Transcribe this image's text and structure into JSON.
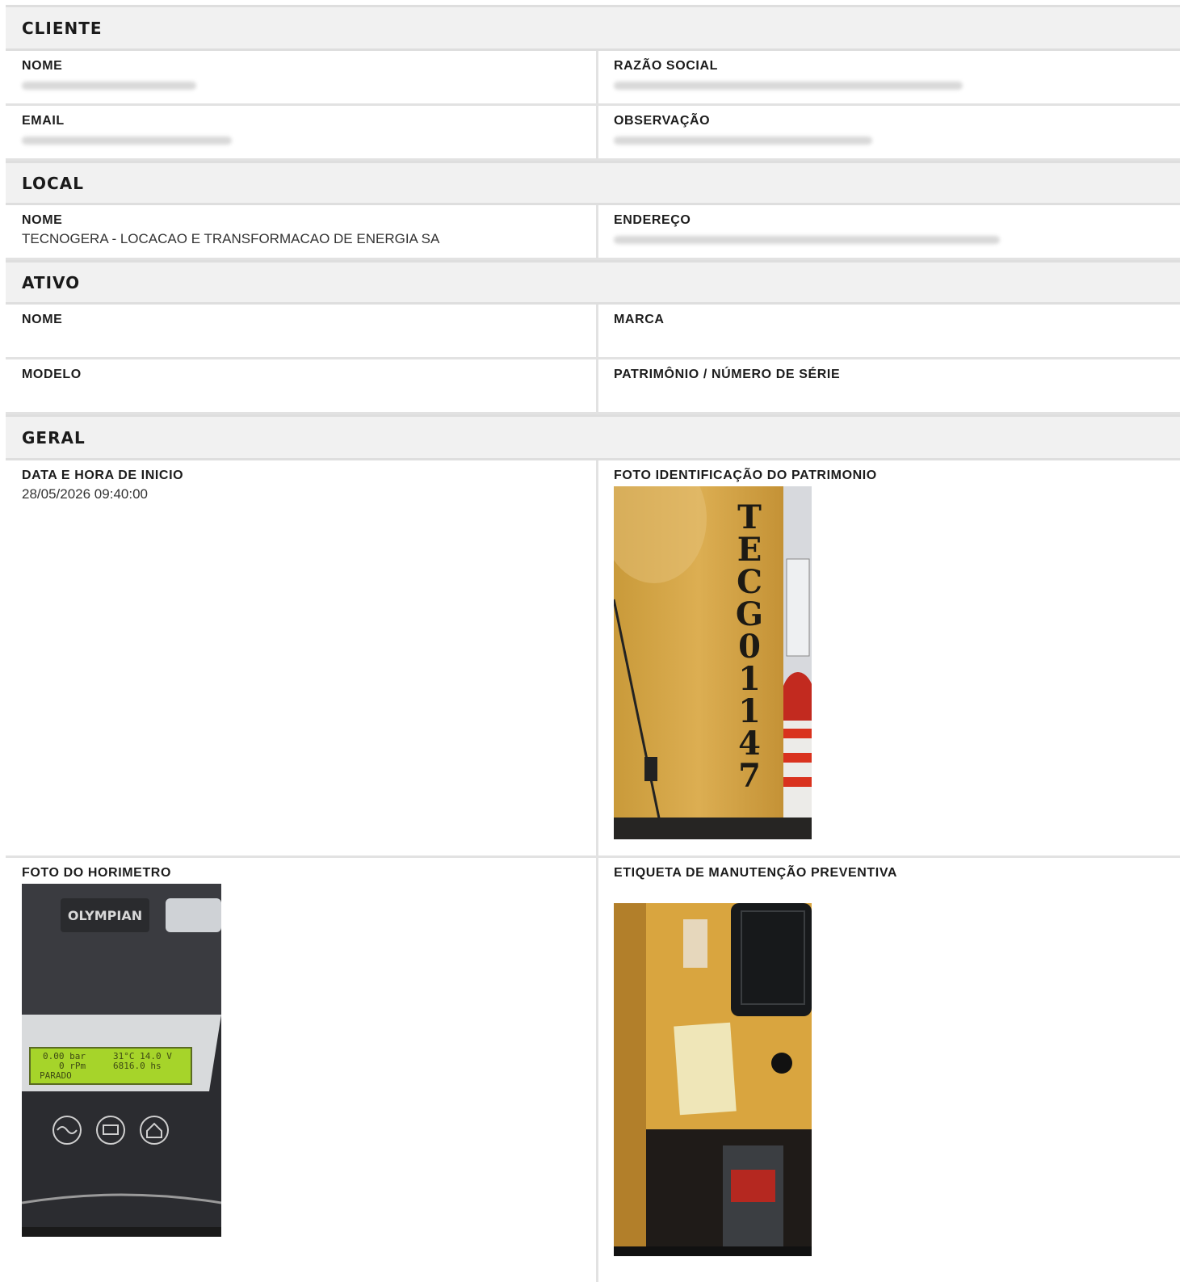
{
  "sections": {
    "cliente": {
      "title": "CLIENTE",
      "nome_label": "NOME",
      "razao_label": "RAZÃO SOCIAL",
      "email_label": "EMAIL",
      "obs_label": "OBSERVAÇÃO"
    },
    "local": {
      "title": "LOCAL",
      "nome_label": "NOME",
      "nome_value": "TECNOGERA - LOCACAO E TRANSFORMACAO DE ENERGIA SA",
      "endereco_label": "ENDEREÇO"
    },
    "ativo": {
      "title": "ATIVO",
      "nome_label": "NOME",
      "marca_label": "MARCA",
      "modelo_label": "MODELO",
      "patrimonio_label": "PATRIMÔNIO / NÚMERO DE SÉRIE"
    },
    "geral": {
      "title": "GERAL",
      "inicio_label": "DATA E HORA DE INICIO",
      "inicio_value": "28/05/2026 09:40:00",
      "foto_patrimonio_label": "FOTO IDENTIFICAÇÃO DO PATRIMONIO",
      "foto_horimetro_label": "FOTO DO HORIMETRO",
      "etiqueta_label": "ETIQUETA DE MANUTENÇÃO PREVENTIVA"
    }
  },
  "photos": {
    "patrimonio_stencil": "TECG01147",
    "horimetro_brand": "OLYMPIAN",
    "lcd_line1_left": "0.00 bar",
    "lcd_line1_right": "31°C  14.0 V",
    "lcd_line2_left": "0 rPm",
    "lcd_line2_right": "6816.0 hs",
    "lcd_line3": "PARADO"
  },
  "colors": {
    "header_bg": "#f1f1f1",
    "border": "#e2e2e2",
    "lcd_green": "#a6d42a",
    "panel_yellow": "#d9a53f"
  }
}
